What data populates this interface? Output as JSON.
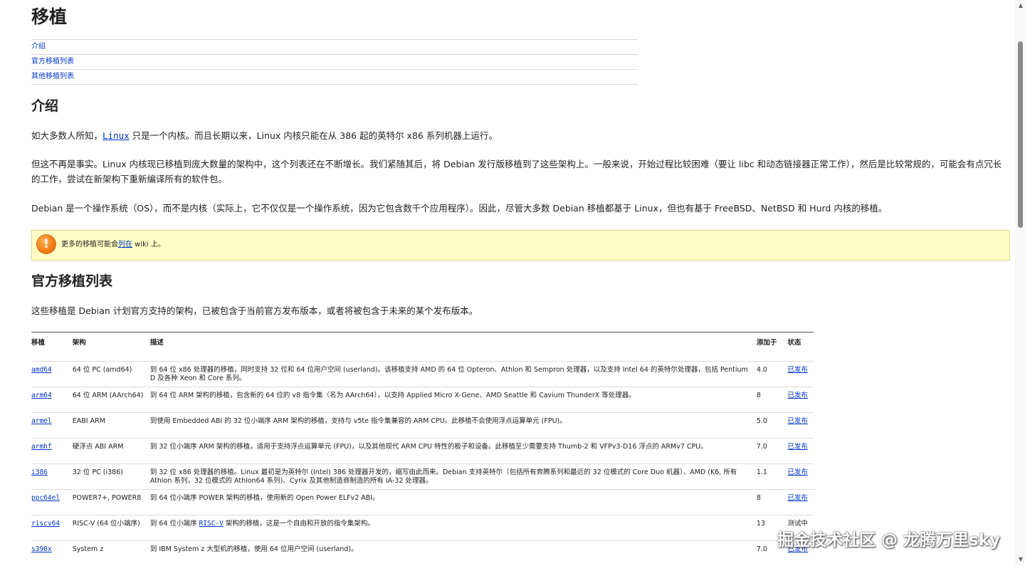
{
  "page": {
    "title": "移植",
    "toc": [
      "介绍",
      "官方移植列表",
      "其他移植列表"
    ]
  },
  "intro": {
    "heading": "介绍",
    "p1_before": "如大多数人所知，",
    "p1_link": "Linux",
    "p1_after": " 只是一个内核。而且长期以来，Linux 内核只能在从 386 起的英特尔 x86 系列机器上运行。",
    "p2": "但这不再是事实。Linux 内核现已移植到庞大数量的架构中，这个列表还在不断增长。我们紧随其后，将 Debian 发行版移植到了这些架构上。一般来说，开始过程比较困难（要让 libc 和动态链接器正常工作），然后是比较常规的，可能会有点冗长的工作，尝试在新架构下重新编译所有的软件包。",
    "p3": "Debian 是一个操作系统（OS），而不是内核（实际上，它不仅仅是一个操作系统，因为它包含数千个应用程序）。因此，尽管大多数 Debian 移植都基于 Linux，但也有基于 FreeBSD、NetBSD 和 Hurd 内核的移植。"
  },
  "warning": {
    "icon": "warning-icon",
    "text_before": "更多的移植可能会",
    "link": "列在",
    "text_after": " wiki 上。"
  },
  "official": {
    "heading": "官方移植列表",
    "desc": "这些移植是 Debian 计划官方支持的架构，已被包含于当前官方发布版本，或者将被包含于未来的某个发布版本。",
    "columns": [
      "移植",
      "架构",
      "描述",
      "添加于",
      "状态"
    ],
    "rows": [
      {
        "port": "amd64",
        "arch": "64 位 PC (amd64)",
        "desc": "到 64 位 x86 处理器的移植，同时支持 32 位和 64 位用户空间 (userland)。该移植支持 AMD 的 64 位 Opteron、Athlon 和 Sempron 处理器，以及支持 Intel 64 的英特尔处理器，包括 Pentium D 及各种 Xeon 和 Core 系列。",
        "added": "4.0",
        "status": "已发布"
      },
      {
        "port": "arm64",
        "arch": "64 位 ARM (AArch64)",
        "desc": "到 64 位 ARM 架构的移植，包含新的 64 位的 v8 指令集（名为 AArch64），以支持 Applied Micro X-Gene、AMD Seattle 和 Cavium ThunderX 等处理器。",
        "added": "8",
        "status": "已发布"
      },
      {
        "port": "armel",
        "arch": "EABI ARM",
        "desc": "到使用 Embedded ABI 的 32 位小端序 ARM 架构的移植，支持与 v5te 指令集兼容的 ARM CPU。此移植不会使用浮点运算单元 (FPU)。",
        "added": "5.0",
        "status": "已发布"
      },
      {
        "port": "armhf",
        "arch": "硬浮点 ABI ARM",
        "desc": "到 32 位小端序 ARM 架构的移植，适用于支持浮点运算单元 (FPU)，以及其他现代 ARM CPU 特性的板子和设备。此移植至少需要支持 Thumb-2 和 VFPv3-D16 浮点的 ARMv7 CPU。",
        "added": "7.0",
        "status": "已发布"
      },
      {
        "port": "i386",
        "arch": "32 位 PC (i386)",
        "desc": "到 32 位 x86 处理器的移植。Linux 最初是为英特尔 (Intel) 386 处理器开发的，缩写由此而来。Debian 支持英特尔（包括所有奔腾系列和最近的 32 位模式的 Core Duo 机器）、AMD (K6, 所有 Athlon 系列，32 位模式的 Athlon64 系列)、Cyrix 及其他制造商制造的所有 IA-32 处理器。",
        "added": "1.1",
        "status": "已发布"
      },
      {
        "port": "ppc64el",
        "arch": "POWER7+, POWER8",
        "desc": "到 64 位小端序 POWER 架构的移植，使用新的 Open Power ELFv2 ABI。",
        "added": "8",
        "status": "已发布"
      },
      {
        "port": "riscv64",
        "arch": "RISC-V (64 位小端序)",
        "desc_before": "到 64 位小端序 ",
        "desc_link": "RISC-V",
        "desc_after": " 架构的移植，这是一个自由和开放的指令集架构。",
        "added": "13",
        "status": "测试中"
      },
      {
        "port": "s390x",
        "arch": "System z",
        "desc": "到 IBM System z 大型机的移植，使用 64 位用户空间 (userland)。",
        "added": "7.0",
        "status": "已发布"
      }
    ]
  },
  "watermark": "掘金技术社区 @ 龙腾万里sky"
}
